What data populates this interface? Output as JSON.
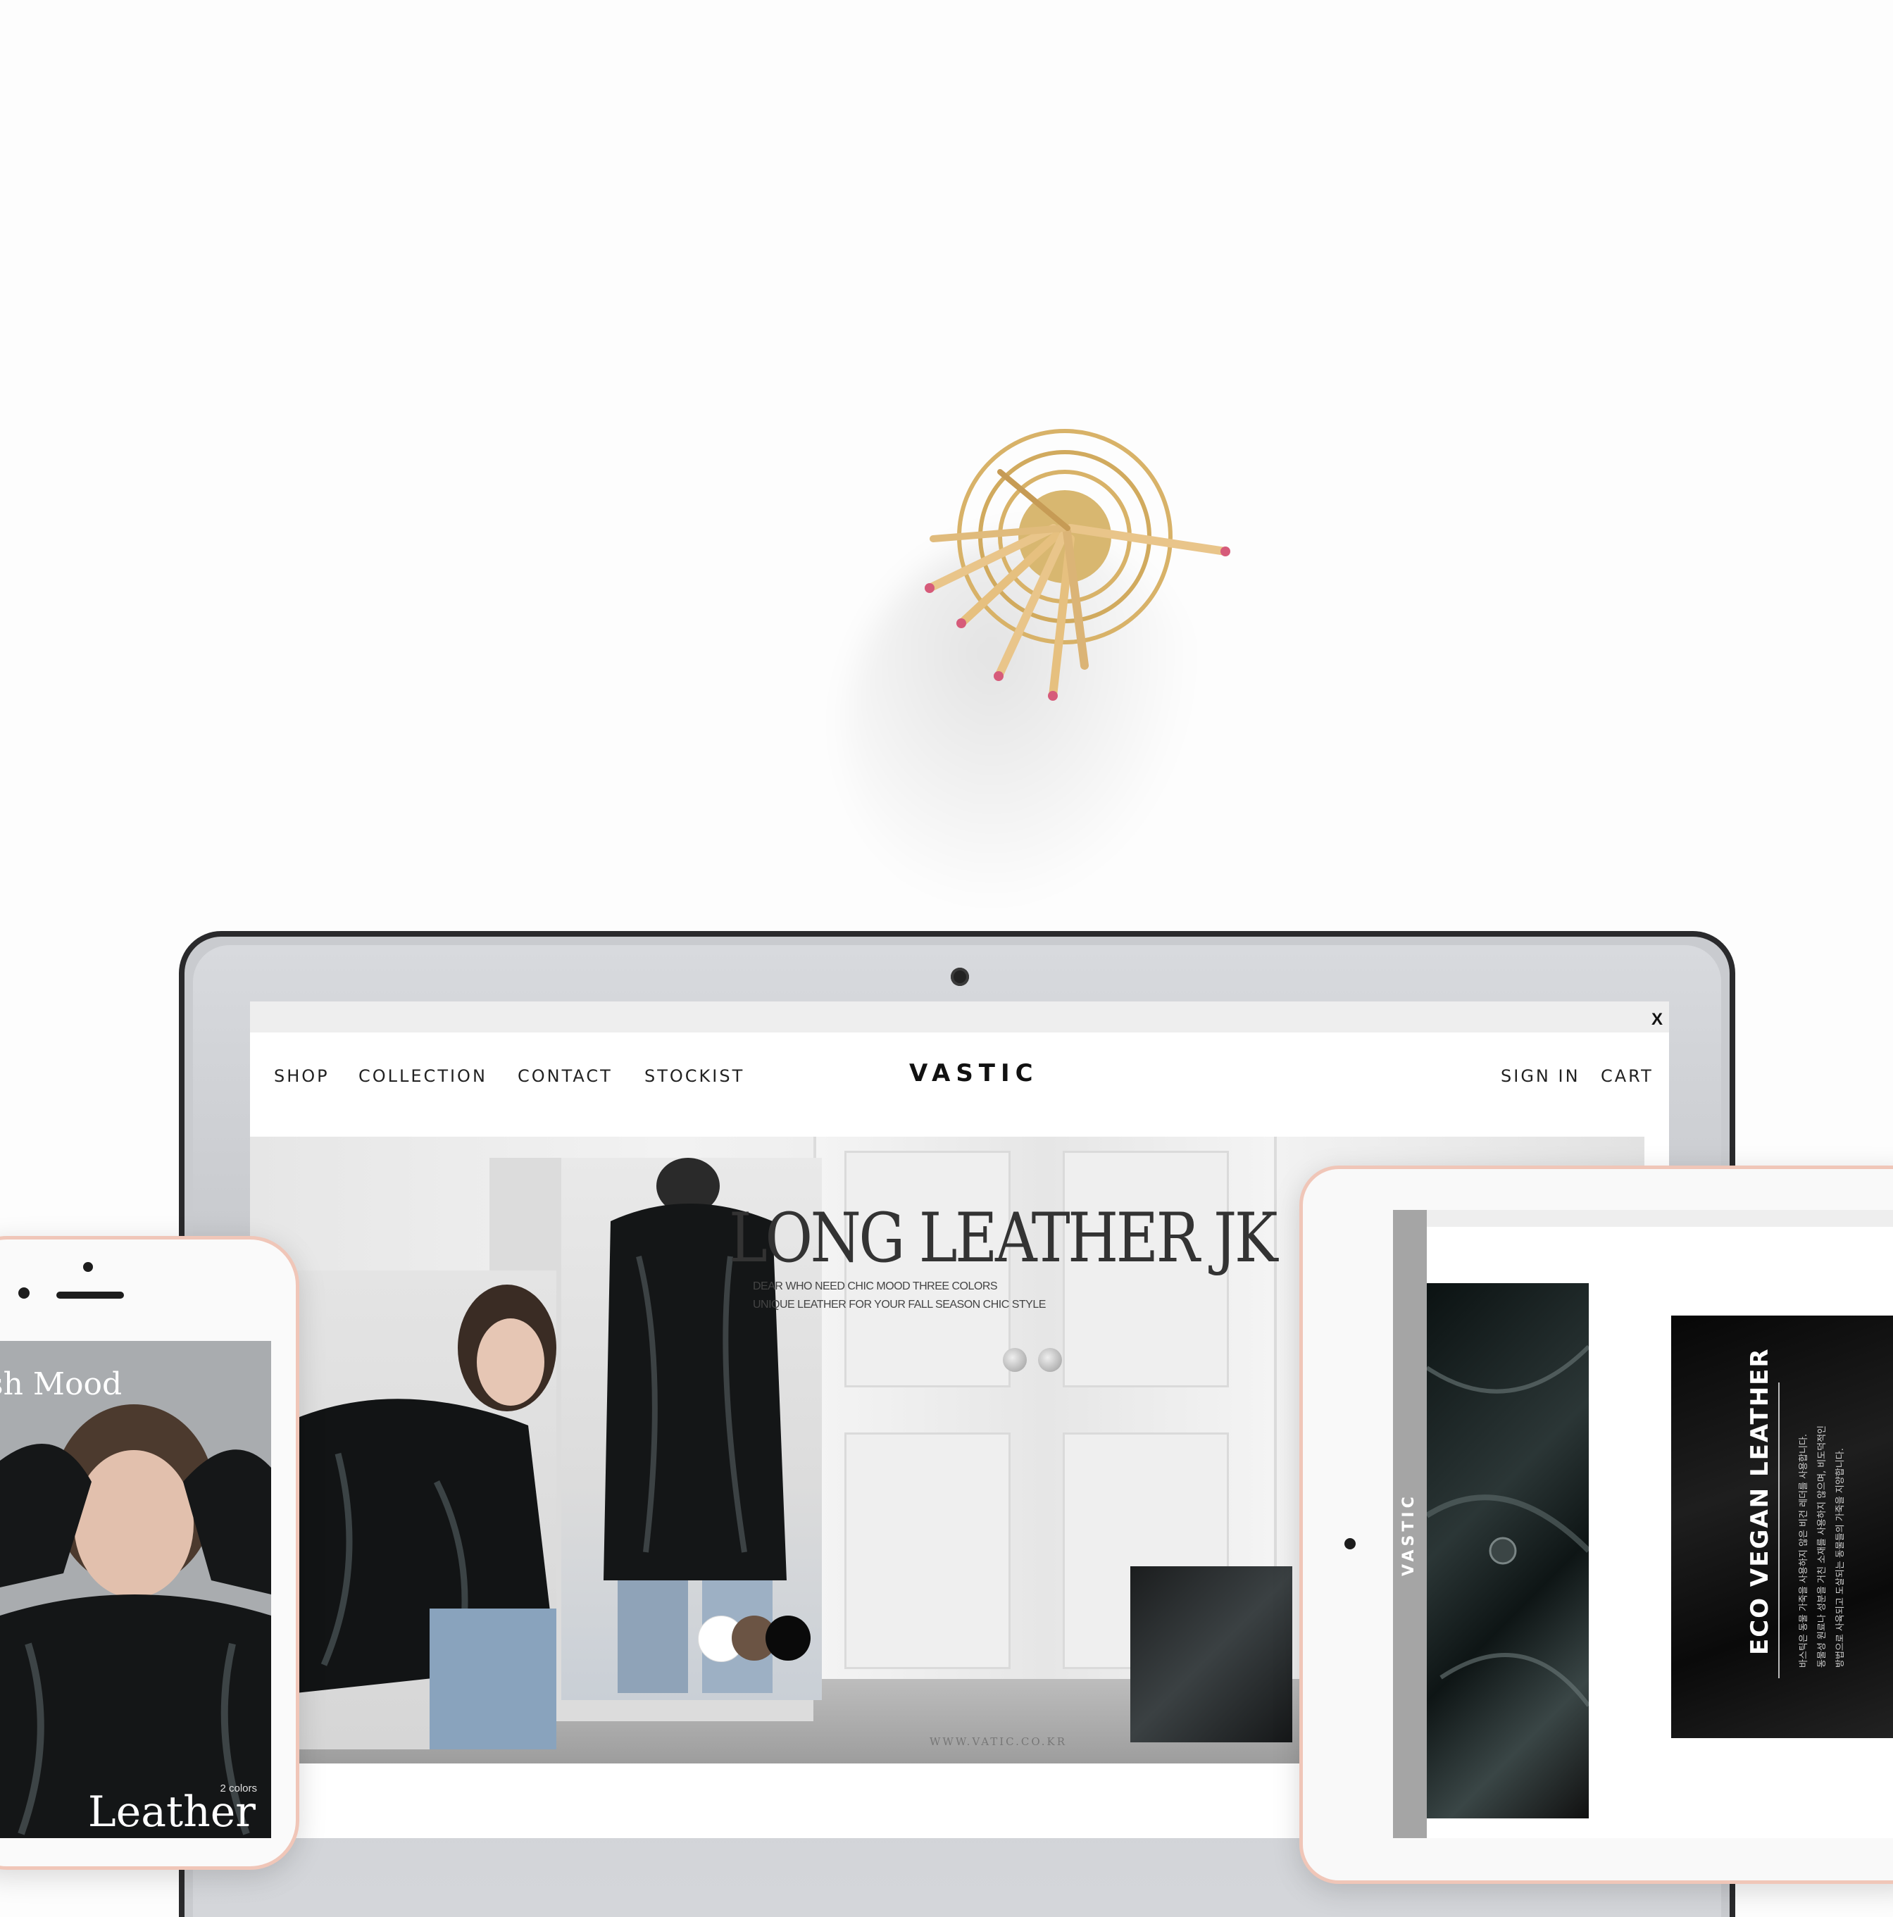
{
  "laptop_site": {
    "close_label": "X",
    "nav_left": [
      "SHOP",
      "COLLECTION",
      "CONTACT",
      "STOCKIST"
    ],
    "brand": "VASTIC",
    "nav_right": [
      "SIGN IN",
      "CART"
    ],
    "hero": {
      "title": "LONG LEATHER JK",
      "subtitle_lines": [
        "DEAR WHO NEED CHIC MOOD THREE COLORS",
        "UNIQUE LEATHER FOR YOUR FALL SEASON CHIC STYLE"
      ],
      "color_swatches": [
        "#ffffff",
        "#6b5444",
        "#0a0a0a"
      ],
      "url": "WWW.VATIC.CO.KR"
    }
  },
  "phone_site": {
    "headline_fragment": "sh Mood",
    "colors_note": "2 colors",
    "product_word": "Leather"
  },
  "tablet_site": {
    "side_brand": "VASTIC",
    "feature_title": "ECO VEGAN LEATHER",
    "feature_body_lines": [
      "바스틱은 동물 가죽을 사용하지 않은 비건 레더를 사용합니다.",
      "동물성 원료나 성분을 거친 소재를 사용하지 않으며, 비도덕적인",
      "방법으로 사육되고 도살되는 동물들의 가죽을 지양합니다."
    ]
  },
  "colors": {
    "rose_gold": "#f0c6b8",
    "laptop_frame": "#c9cbcf"
  }
}
